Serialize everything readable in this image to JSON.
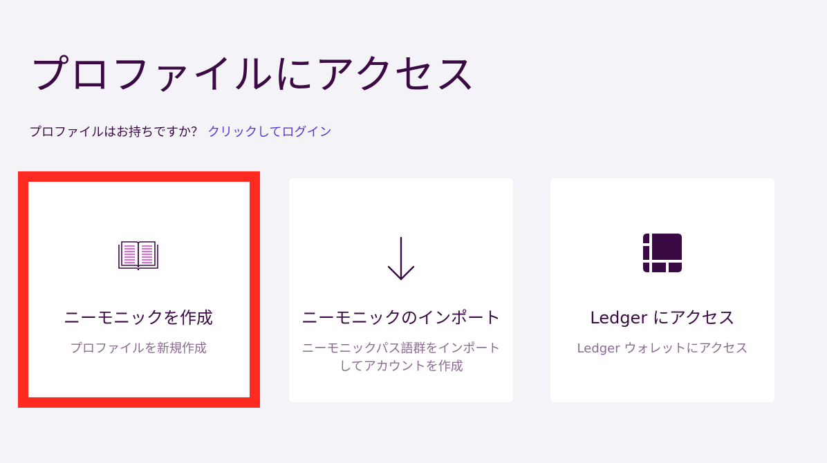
{
  "page": {
    "title": "プロファイルにアクセス",
    "subtitle_prefix": "プロファイルはお持ちですか？",
    "login_link": "クリックしてログイン"
  },
  "cards": [
    {
      "icon": "open-book-icon",
      "title": "ニーモニックを作成",
      "description": "プロファイルを新規作成"
    },
    {
      "icon": "arrow-down-icon",
      "title": "ニーモニックのインポート",
      "description_line1": "ニーモニックパス語群をインポート",
      "description_line2": "してアカウントを作成"
    },
    {
      "icon": "ledger-icon",
      "title": "Ledger にアクセス",
      "description": "Ledger ウォレットにアクセス"
    }
  ],
  "colors": {
    "background": "#f4f4f8",
    "primary_text": "#3b0a45",
    "muted_text": "#8a6a90",
    "link": "#5b35d5",
    "highlight_border": "#ff2a1f",
    "book_accent": "#e040e0"
  }
}
